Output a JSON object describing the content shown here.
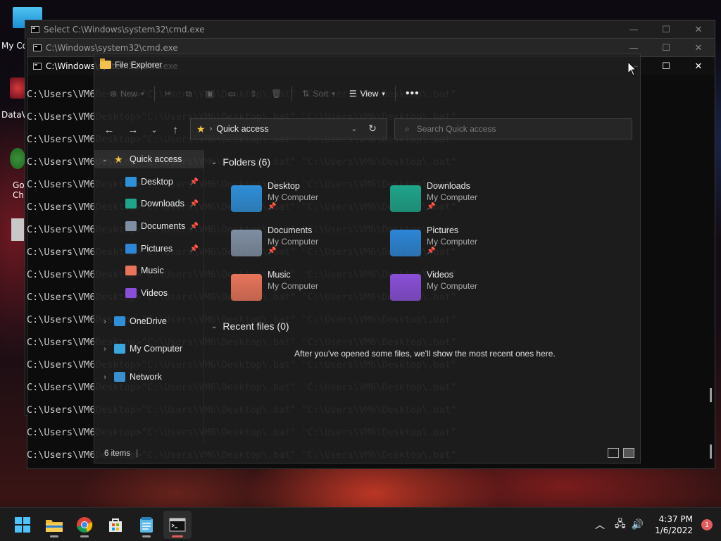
{
  "desktop": {
    "icons": [
      {
        "label": "My Co"
      },
      {
        "label": "DataV"
      },
      {
        "label": "Go"
      },
      {
        "label": "Ch"
      }
    ]
  },
  "cmd_windows": [
    {
      "title": "Select C:\\Windows\\system32\\cmd.exe"
    },
    {
      "title": "C:\\Windows\\system32\\cmd.exe"
    },
    {
      "title": "C:\\Windows\\system32\\cmd.exe"
    }
  ],
  "cmd": {
    "lines_visible": [
      "C:\\Users\\VM6",
      "C:\\Users\\VM6",
      "C:\\Users\\VM6",
      "C:\\Users\\VM6",
      "C:\\Users\\VM6",
      "C:\\Users\\VM6",
      "C:\\Users\\VM6",
      "C:\\Users\\VM6",
      "C:\\Users\\VM6",
      "C:\\Users\\VM6",
      "C:\\Users\\VM6",
      "C:\\Users\\VM6",
      "C:\\Users\\VM6",
      "C:\\Users\\VM6",
      "C:\\Users\\VM6",
      "C:\\Users\\VM6",
      "C:\\Users\\VM6"
    ],
    "ghost_text": "Desktop>\"C:\\Users\\VM6\\Desktop\\.bat\" \"C:\\Users\\VM6\\Desktop\\.bat\""
  },
  "explorer": {
    "title": "File Explorer",
    "toolbar": {
      "new": "New",
      "sort": "Sort",
      "view": "View",
      "more": "•••"
    },
    "address": "Quick access",
    "search_placeholder": "Search Quick access",
    "sidebar": [
      {
        "label": "Quick access",
        "icon": "star-icon",
        "pinned": false
      },
      {
        "label": "Desktop",
        "icon": "desktop-folder-icon",
        "pinned": true
      },
      {
        "label": "Downloads",
        "icon": "downloads-folder-icon",
        "pinned": true
      },
      {
        "label": "Documents",
        "icon": "documents-folder-icon",
        "pinned": true
      },
      {
        "label": "Pictures",
        "icon": "pictures-folder-icon",
        "pinned": true
      },
      {
        "label": "Music",
        "icon": "music-folder-icon",
        "pinned": false
      },
      {
        "label": "Videos",
        "icon": "videos-folder-icon",
        "pinned": false
      },
      {
        "label": "OneDrive",
        "icon": "onedrive-icon",
        "pinned": false
      },
      {
        "label": "My Computer",
        "icon": "computer-icon",
        "pinned": false
      },
      {
        "label": "Network",
        "icon": "network-icon",
        "pinned": false
      }
    ],
    "folders_header": "Folders (6)",
    "folders": [
      {
        "name": "Desktop",
        "location": "My Computer",
        "pinned": true,
        "color": "#2f8fd8"
      },
      {
        "name": "Downloads",
        "location": "My Computer",
        "pinned": true,
        "color": "#1ea58a"
      },
      {
        "name": "Documents",
        "location": "My Computer",
        "pinned": true,
        "color": "#7f8fa3"
      },
      {
        "name": "Pictures",
        "location": "My Computer",
        "pinned": true,
        "color": "#2d86d6"
      },
      {
        "name": "Music",
        "location": "My Computer",
        "pinned": false,
        "color": "#e8745a"
      },
      {
        "name": "Videos",
        "location": "My Computer",
        "pinned": false,
        "color": "#8a4fd8"
      }
    ],
    "recent_header": "Recent files (0)",
    "recent_empty": "After you've opened some files, we'll show the most recent ones here.",
    "status": "6 items"
  },
  "taskbar": {
    "time": "4:37 PM",
    "date": "1/6/2022",
    "notifications": "1"
  }
}
